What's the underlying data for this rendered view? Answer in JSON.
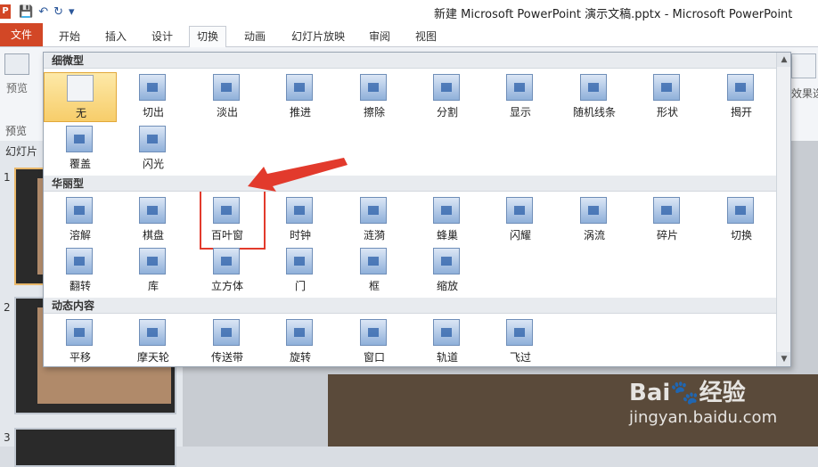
{
  "window": {
    "title": "新建 Microsoft PowerPoint 演示文稿.pptx  -  Microsoft PowerPoint"
  },
  "qat": {
    "app_icon": "P",
    "save_icon": "💾",
    "undo_icon": "↶",
    "redo_icon": "↻",
    "more_icon": "▾"
  },
  "tabs": [
    {
      "label": "文件"
    },
    {
      "label": "开始"
    },
    {
      "label": "插入"
    },
    {
      "label": "设计"
    },
    {
      "label": "切换"
    },
    {
      "label": "动画"
    },
    {
      "label": "幻灯片放映"
    },
    {
      "label": "审阅"
    },
    {
      "label": "视图"
    }
  ],
  "ribbon": {
    "preview_label": "预览",
    "preview_group": "预览",
    "effect_label": "效果选"
  },
  "left_pane": {
    "title": "幻灯片",
    "slide_numbers": [
      "1",
      "2",
      "3"
    ]
  },
  "gallery": {
    "sections": [
      {
        "title": "细微型",
        "items": [
          "无",
          "切出",
          "淡出",
          "推进",
          "擦除",
          "分割",
          "显示",
          "随机线条",
          "形状",
          "揭开",
          "覆盖",
          "闪光"
        ]
      },
      {
        "title": "华丽型",
        "items": [
          "溶解",
          "棋盘",
          "百叶窗",
          "时钟",
          "涟漪",
          "蜂巢",
          "闪耀",
          "涡流",
          "碎片",
          "切换",
          "翻转",
          "库",
          "立方体",
          "门",
          "框",
          "缩放"
        ]
      },
      {
        "title": "动态内容",
        "items": [
          "平移",
          "摩天轮",
          "传送带",
          "旋转",
          "窗口",
          "轨道",
          "飞过"
        ]
      }
    ],
    "selected_item": "无",
    "highlighted_item": "百叶窗"
  },
  "scroll": {
    "up": "▲",
    "down": "▼"
  },
  "watermark": {
    "brand": "Bai🐾经验",
    "url": "jingyan.baidu.com"
  },
  "colors": {
    "file_tab": "#d24726",
    "highlight": "#e23a2c",
    "selected": "#f7cd6a"
  }
}
